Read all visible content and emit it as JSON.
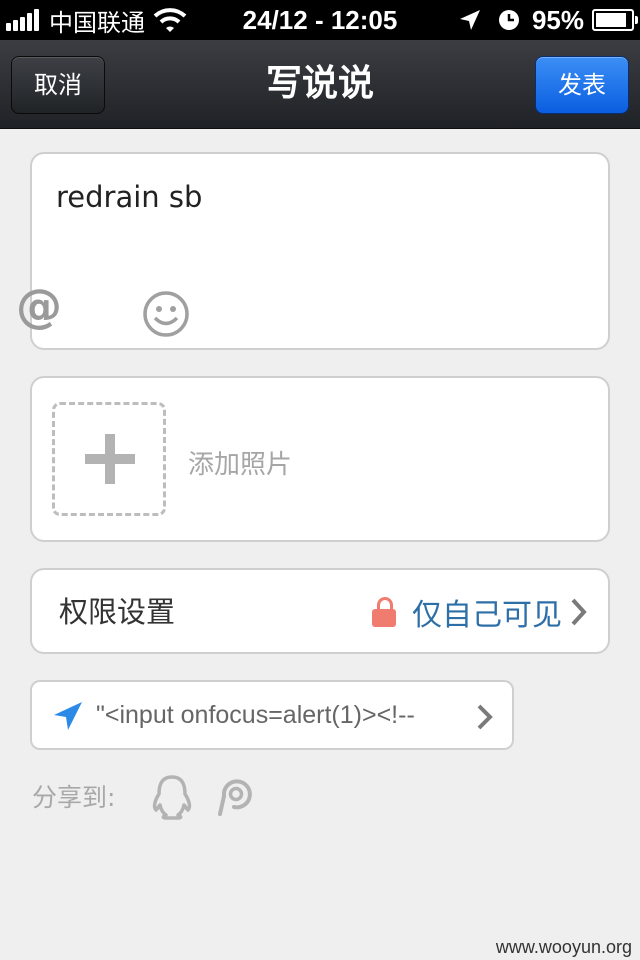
{
  "status_bar": {
    "carrier": "中国联通",
    "time": "24/12 - 12:05",
    "battery": "95%",
    "icons": [
      "signal-icon",
      "wifi-icon",
      "location-arrow-icon",
      "clock-icon",
      "battery-icon"
    ]
  },
  "nav": {
    "cancel_label": "取消",
    "title": "写说说",
    "post_label": "发表",
    "post_color": "#1464e6"
  },
  "compose": {
    "text": "redrain sb",
    "icons": [
      "at-icon",
      "smiley-icon"
    ]
  },
  "photo": {
    "add_label": "添加照片",
    "icon": "plus-icon"
  },
  "permission": {
    "label": "权限设置",
    "value": "仅自己可见",
    "icon": "lock-icon",
    "value_color": "#2e6fa8"
  },
  "location": {
    "text": "\"<input onfocus=alert(1)><!--",
    "icon": "location-arrow-icon"
  },
  "share": {
    "label": "分享到:",
    "icons": [
      "qq-icon",
      "pengyou-icon"
    ]
  },
  "watermark": "www.wooyun.org"
}
